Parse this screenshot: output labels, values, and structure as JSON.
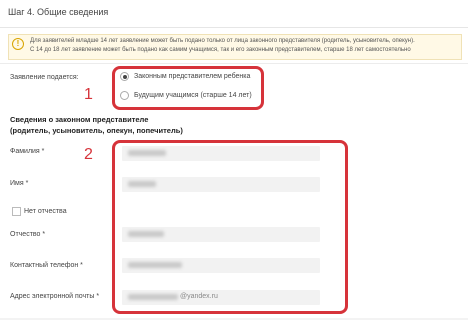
{
  "step_title": "Шаг 4. Общие сведения",
  "notice": {
    "icon": "info-icon",
    "line1": "Для заявителей младше 14 лет заявление может быть подано только от лица законного представителя (родитель, усыновитель, опекун).",
    "line2": "С 14 до 18 лет заявление может быть подано как самим учащимся, так и его законным представителем, старше 18 лет самостоятельно"
  },
  "submitted_by": {
    "label": "Заявление подается:",
    "options": [
      {
        "label": "Законным представителем ребенка",
        "selected": true
      },
      {
        "label": "Будущим учащимся (старше 14 лет)",
        "selected": false
      }
    ]
  },
  "representative": {
    "title_line1": "Сведения о законном представителе",
    "title_line2": "(родитель, усыновитель, опекун, попечитель)",
    "fields": {
      "surname": "Фамилия *",
      "name": "Имя *",
      "no_patronymic": "Нет отчества",
      "patronymic": "Отчество *",
      "phone": "Контактный телефон *",
      "email": "Адрес электронной почты *",
      "email_suffix": "@yandex.ru"
    }
  },
  "annotations": {
    "one": "1",
    "two": "2"
  },
  "colors": {
    "annotation": "#d6333a",
    "notice_bg": "#fff9e6",
    "field_bg": "#f2f2f2"
  }
}
